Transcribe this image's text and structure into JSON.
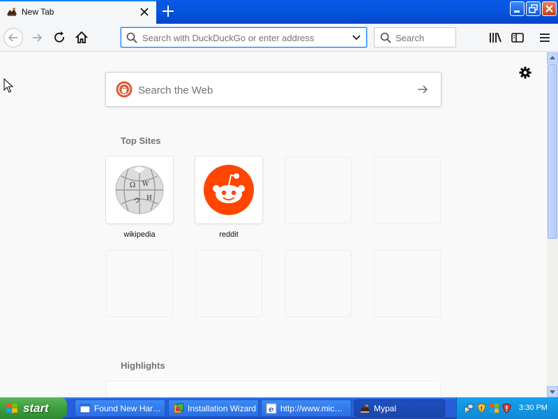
{
  "tab": {
    "title": "New Tab"
  },
  "urlbar": {
    "placeholder": "Search with DuckDuckGo or enter address"
  },
  "searchbar": {
    "placeholder": "Search"
  },
  "newtab": {
    "web_search_placeholder": "Search the Web",
    "top_sites_title": "Top Sites",
    "highlights_title": "Highlights",
    "top_sites": [
      {
        "label": "wikipedia",
        "icon": "wikipedia-icon"
      },
      {
        "label": "reddit",
        "icon": "reddit-icon"
      }
    ]
  },
  "taskbar": {
    "start_label": "start",
    "tasks": [
      {
        "label": "Found New Har…",
        "icon": "window-icon"
      },
      {
        "label": "Installation Wizard",
        "icon": "setup-icon"
      },
      {
        "label": "http://www.mic…",
        "icon": "ie-icon"
      },
      {
        "label": "Mypal",
        "icon": "mypal-icon"
      }
    ],
    "clock": "3:30 PM"
  },
  "colors": {
    "xp_blue": "#245edb",
    "start_green": "#3c9e3c",
    "accent": "#0a84ff",
    "reddit": "#ff4500",
    "ddg": "#de5833"
  }
}
